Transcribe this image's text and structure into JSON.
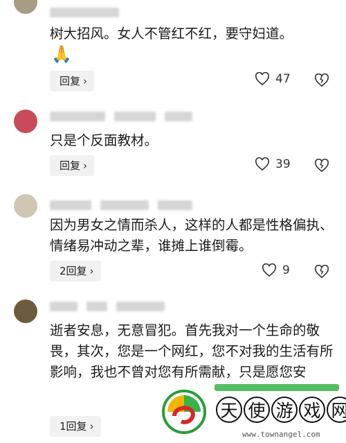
{
  "comments": [
    {
      "text": "树大招风。女人不管红不红，要守妇道。",
      "emoji": "🙏",
      "reply_label": "回复",
      "likes": "47"
    },
    {
      "text": "只是个反面教材。",
      "reply_label": "回复",
      "likes": "39"
    },
    {
      "text": "因为男女之情而杀人，这样的人都是性格偏执、情绪易冲动之辈，谁摊上谁倒霉。",
      "reply_label": "2回复",
      "likes": "9"
    },
    {
      "text": "逝者安息，无意冒犯。首先我对一个生命的敬畏，其次，您是一个网红，您不对我的生活有所影响，我也不曾对您有所需献，只是愿您安",
      "reply_label": "1回复"
    }
  ],
  "watermark": {
    "chars": [
      "天",
      "使",
      "游",
      "戏",
      "网"
    ],
    "url": "www.townangel.com"
  },
  "icons": {
    "like": "heart-outline-icon",
    "dislike": "broken-heart-icon",
    "chevron": "chevron-right-icon"
  }
}
